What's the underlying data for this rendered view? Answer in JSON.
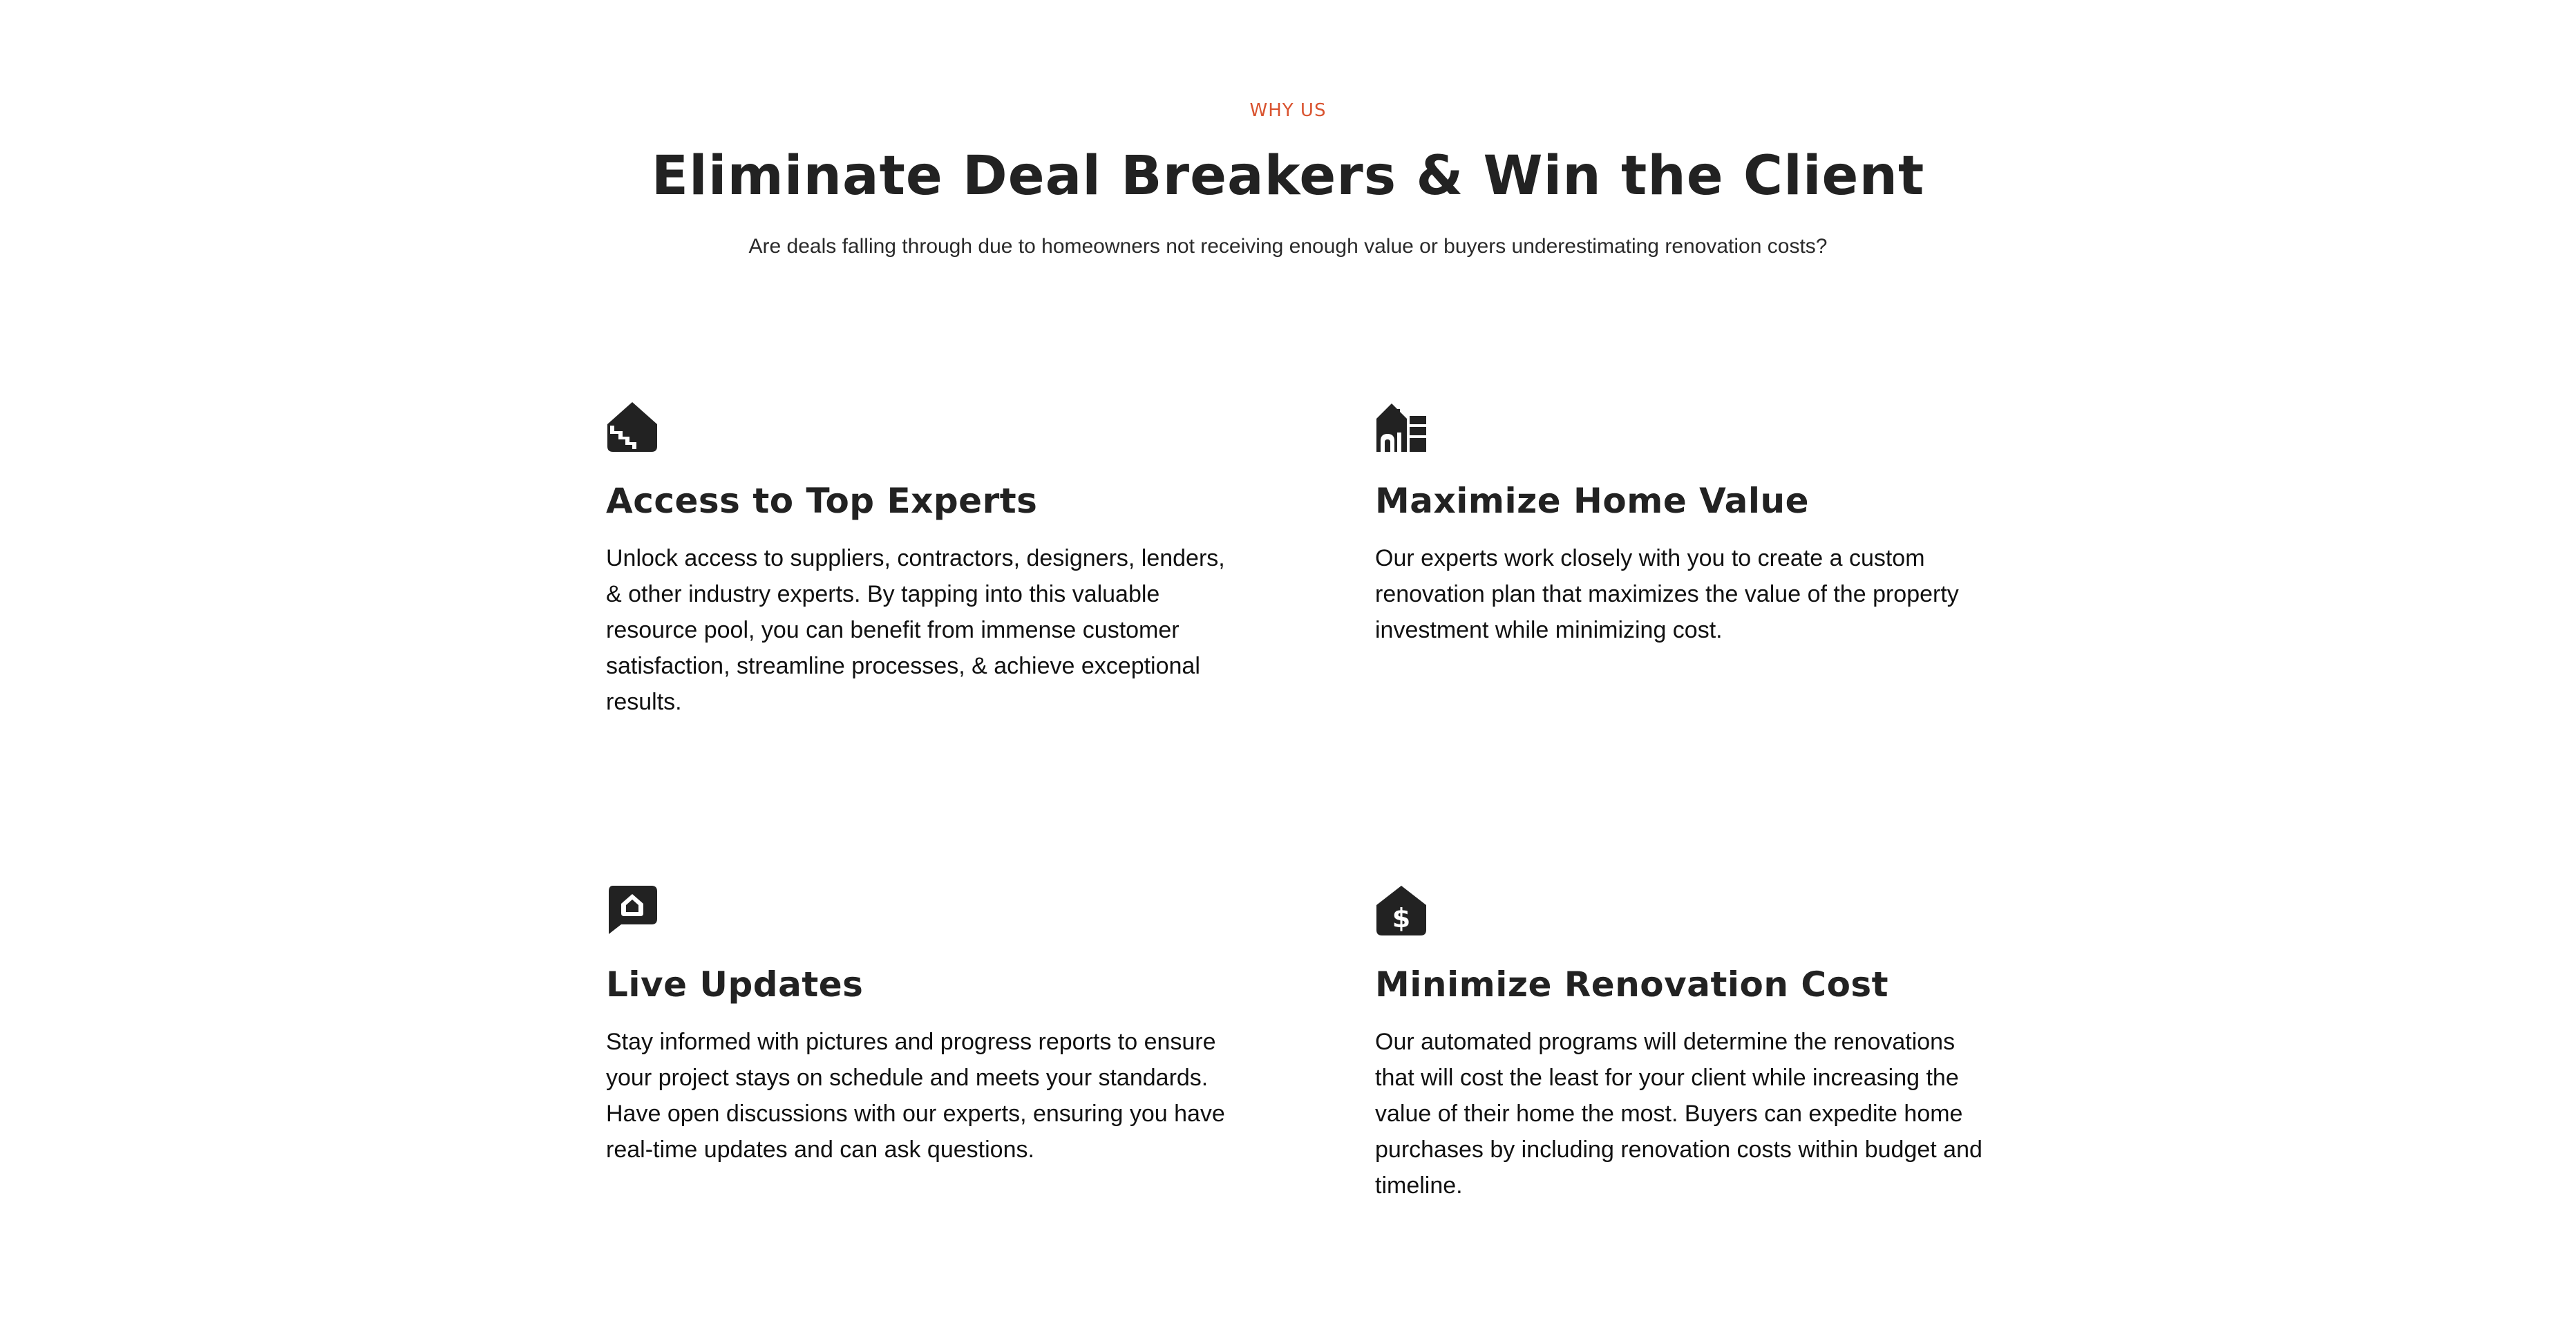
{
  "header": {
    "eyebrow": "WHY US",
    "title": "Eliminate Deal Breakers & Win the Client",
    "subtitle": "Are deals falling through due to homeowners not receiving enough value or buyers underestimating renovation costs?"
  },
  "colors": {
    "accent": "#d9532f",
    "text": "#222222",
    "icon": "#222222"
  },
  "features": [
    {
      "icon": "house-stairs-icon",
      "title": "Access to Top Experts",
      "text": "Unlock access to suppliers, contractors, designers, lenders, & other industry experts. By tapping into this valuable resource pool, you can benefit from immense customer satisfaction, streamline processes, & achieve exceptional results."
    },
    {
      "icon": "house-building-icon",
      "title": "Maximize Home Value",
      "text": "Our experts work closely with you to create a custom renovation plan that maximizes the value of the property investment while minimizing cost."
    },
    {
      "icon": "chat-house-icon",
      "title": "Live Updates",
      "text": "Stay informed with pictures and progress reports to ensure your project stays on schedule and meets your standards. Have open discussions with our experts, ensuring you have real-time updates and can ask questions."
    },
    {
      "icon": "house-dollar-icon",
      "title": "Minimize Renovation Cost",
      "text": "Our automated programs will determine the renovations that will cost the least for your client while increasing the value of their home the most. Buyers can expedite home purchases by including renovation costs within budget and timeline."
    }
  ]
}
